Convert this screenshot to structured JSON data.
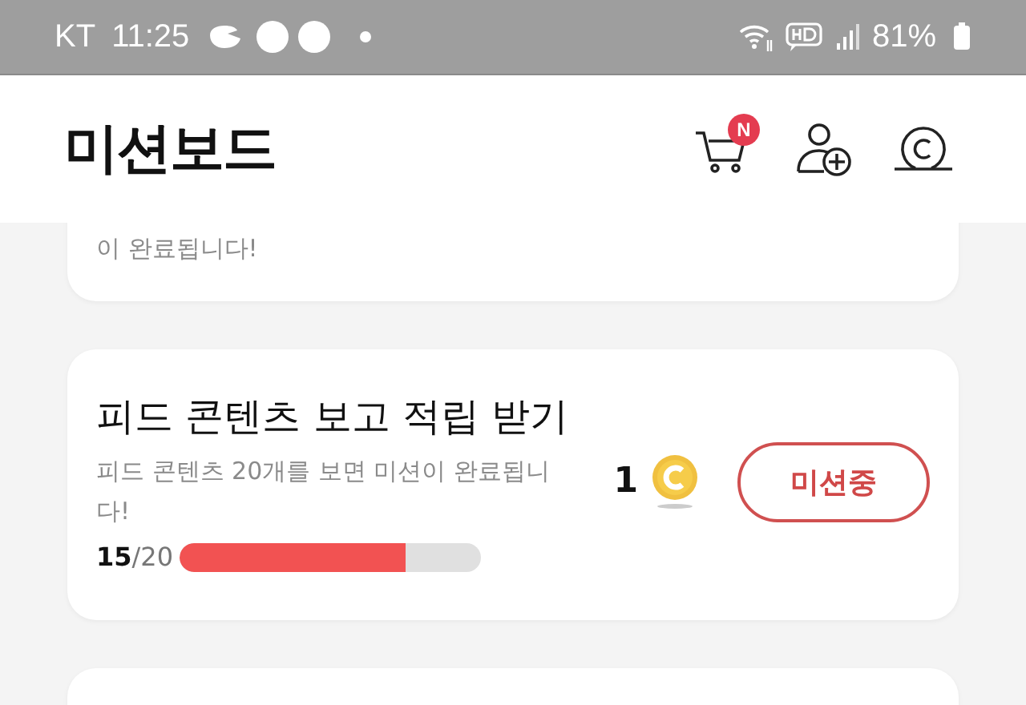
{
  "status_bar": {
    "carrier": "KT",
    "time": "11:25",
    "battery": "81%"
  },
  "header": {
    "title": "미션보드",
    "cart_badge": "N"
  },
  "missions": [
    {
      "kind": "partial_top",
      "description": "이 완료됩니다!"
    },
    {
      "kind": "full",
      "title": "피드 콘텐츠 보고 적립 받기",
      "description": "피드 콘텐츠 20개를 보면 미션이 완료됩니다!",
      "reward": "1",
      "progress_done": "15",
      "progress_total": "/20",
      "level": 0.75,
      "button": "미션중"
    },
    {
      "kind": "partial_bottom"
    }
  ]
}
